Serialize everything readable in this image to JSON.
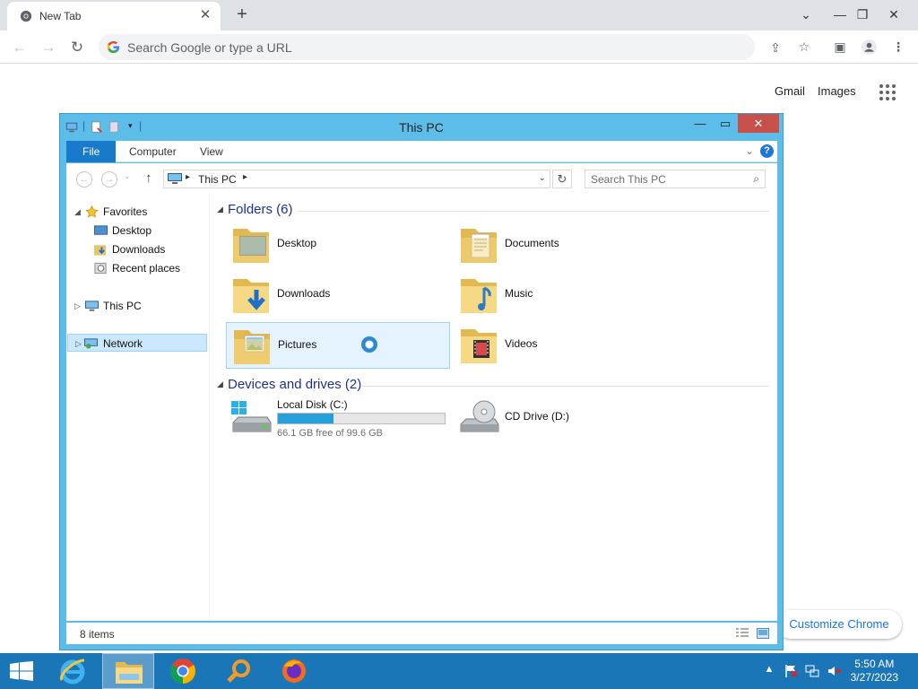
{
  "browser": {
    "tab_title": "New Tab",
    "tab_close": "✕",
    "new_tab": "+",
    "omnibox_placeholder": "Search Google or type a URL",
    "window_controls": [
      "⌄",
      "—",
      "❐",
      "✕"
    ]
  },
  "ntp": {
    "gmail": "Gmail",
    "images": "Images",
    "customize": "Customize Chrome"
  },
  "explorer": {
    "title": "This PC",
    "ribbon_tabs": [
      "File",
      "Computer",
      "View"
    ],
    "help": "?",
    "address_path": "This PC",
    "search_placeholder": "Search This PC",
    "nav": {
      "favorites": "Favorites",
      "desktop": "Desktop",
      "downloads": "Downloads",
      "recent": "Recent places",
      "thispc": "This PC",
      "network": "Network"
    },
    "folders_header": "Folders (6)",
    "folders": [
      "Desktop",
      "Documents",
      "Downloads",
      "Music",
      "Pictures",
      "Videos"
    ],
    "devices_header": "Devices and drives (2)",
    "drives": {
      "c_name": "Local Disk (C:)",
      "c_free": "66.1 GB free of 99.6 GB",
      "c_used_fraction": 0.336,
      "d_name": "CD Drive (D:)"
    },
    "status_count": "8 items"
  },
  "taskbar": {
    "time": "5:50 AM",
    "date": "3/27/2023"
  },
  "colors": {
    "explorer_frame": "#5dbde9",
    "file_tab": "#1979ca",
    "close_button": "#c7504a",
    "taskbar": "#1b76b8",
    "selection": "#cce8ff",
    "progress": "#26a0da"
  }
}
